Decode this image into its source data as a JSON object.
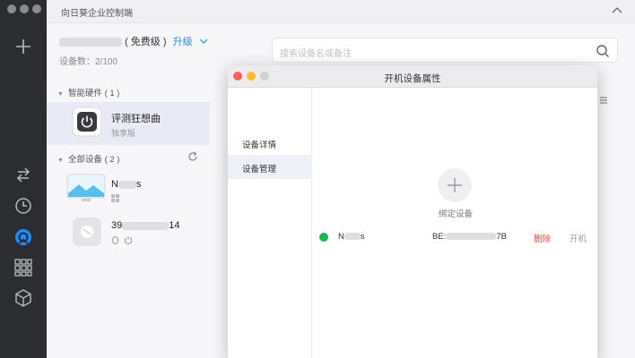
{
  "app": {
    "title": "向日葵企业控制端",
    "account_level": "( 免费级 )",
    "upgrade_label": "升级",
    "device_count": "设备数：2/100",
    "search_placeholder": "搜索设备名或备注"
  },
  "device_list": {
    "groups": [
      {
        "label": "智能硬件 ( 1 )"
      },
      {
        "label": "全部设备 ( 2 )"
      }
    ],
    "smart_device": {
      "name": "评测狂想曲",
      "subtitle": "独享版"
    },
    "devices": [
      {
        "name_prefix": "N",
        "name_suffix": "s"
      },
      {
        "name_prefix": "39",
        "name_suffix": "14"
      }
    ]
  },
  "dialog": {
    "title": "开机设备属性",
    "menu": [
      {
        "label": "设备详情"
      },
      {
        "label": "设备管理"
      }
    ],
    "bind_label": "绑定设备",
    "device_row": {
      "name_prefix": "N",
      "name_suffix": "s",
      "mac_prefix": "BE:",
      "mac_suffix": "7B",
      "delete_label": "删除",
      "boot_label": "开机"
    }
  },
  "colors": {
    "accent": "#1a8cff",
    "online": "#19b94a",
    "danger": "#e64a3b",
    "rail": "#2c2d30"
  }
}
